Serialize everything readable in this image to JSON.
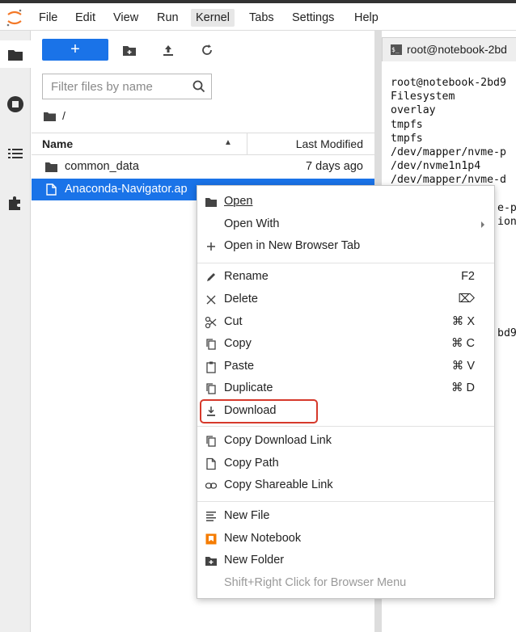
{
  "menubar": {
    "items": [
      "File",
      "Edit",
      "View",
      "Run",
      "Kernel",
      "Tabs",
      "Settings",
      "Help"
    ],
    "active": "Kernel"
  },
  "leftbar": {
    "icons": [
      "folder-icon",
      "running-icon",
      "toc-icon",
      "extension-icon"
    ]
  },
  "filebrowser": {
    "new_label": "+",
    "filter_placeholder": "Filter files by name",
    "breadcrumb": "/",
    "header": {
      "name": "Name",
      "modified": "Last Modified"
    },
    "rows": [
      {
        "name": "common_data",
        "modified": "7 days ago",
        "type": "folder"
      },
      {
        "name": "Anaconda-Navigator.ap",
        "modified": "",
        "type": "file",
        "selected": true
      }
    ]
  },
  "terminal": {
    "tab_label": "root@notebook-2bd",
    "lines": [
      "root@notebook-2bd9",
      "Filesystem",
      "overlay",
      "tmpfs",
      "tmpfs",
      "/dev/mapper/nvme-p",
      "/dev/nvme1n1p4",
      "/dev/mapper/nvme-d",
      "",
      "e-p",
      "ion",
      "",
      "",
      "",
      "",
      "",
      "",
      "",
      "bd9"
    ]
  },
  "context_menu": {
    "items": [
      {
        "key": "open",
        "label": "Open",
        "shortcut": ""
      },
      {
        "key": "open_with",
        "label": "Open With",
        "shortcut": ""
      },
      {
        "key": "open_new_tab",
        "label": "Open in New Browser Tab",
        "shortcut": ""
      },
      {
        "key": "rename",
        "label": "Rename",
        "shortcut": "F2"
      },
      {
        "key": "delete",
        "label": "Delete",
        "shortcut": "⌦"
      },
      {
        "key": "cut",
        "label": "Cut",
        "shortcut": "⌘ X"
      },
      {
        "key": "copy",
        "label": "Copy",
        "shortcut": "⌘ C"
      },
      {
        "key": "paste",
        "label": "Paste",
        "shortcut": "⌘ V"
      },
      {
        "key": "duplicate",
        "label": "Duplicate",
        "shortcut": "⌘ D"
      },
      {
        "key": "download",
        "label": "Download",
        "shortcut": ""
      },
      {
        "key": "copy_download_link",
        "label": "Copy Download Link",
        "shortcut": ""
      },
      {
        "key": "copy_path",
        "label": "Copy Path",
        "shortcut": ""
      },
      {
        "key": "copy_shareable_link",
        "label": "Copy Shareable Link",
        "shortcut": ""
      },
      {
        "key": "new_file",
        "label": "New File",
        "shortcut": ""
      },
      {
        "key": "new_notebook",
        "label": "New Notebook",
        "shortcut": ""
      },
      {
        "key": "new_folder",
        "label": "New Folder",
        "shortcut": ""
      },
      {
        "key": "browser_menu",
        "label": "Shift+Right Click for Browser Menu",
        "shortcut": ""
      }
    ]
  },
  "colors": {
    "accent": "#1a73e8",
    "highlight_border": "#d6392b",
    "notebook_icon": "#f57c00"
  }
}
